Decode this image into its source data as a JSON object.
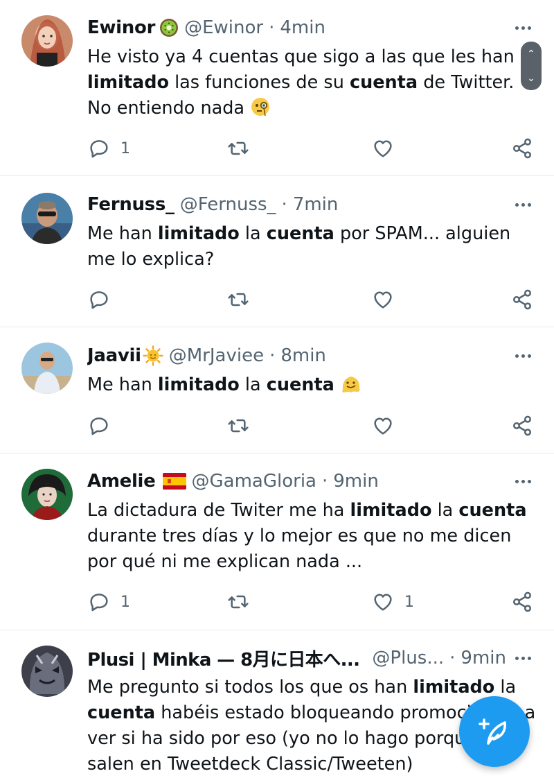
{
  "colors": {
    "accent": "#1d9bf0",
    "text": "#0f1419",
    "muted": "#536471",
    "divider": "#e6e9ec"
  },
  "tweets": [
    {
      "name": "Ewinor",
      "badge": "kiwi-emoji",
      "handle": "@Ewinor",
      "sep": "·",
      "time": "4min",
      "text": [
        {
          "t": "He visto ya 4 cuentas que sigo a las que les han "
        },
        {
          "t": "limitado",
          "b": true
        },
        {
          "t": " las funciones de su "
        },
        {
          "t": "cuenta",
          "b": true
        },
        {
          "t": " de Twitter. No entiendo nada "
        }
      ],
      "trailing_emoji": "monocle-face-emoji",
      "replies": "1",
      "retweets": "",
      "likes": ""
    },
    {
      "name": "Fernuss_",
      "badge": "",
      "handle": "@Fernuss_",
      "sep": "·",
      "time": "7min",
      "text": [
        {
          "t": "Me han "
        },
        {
          "t": "limitado",
          "b": true
        },
        {
          "t": " la "
        },
        {
          "t": "cuenta",
          "b": true
        },
        {
          "t": " por SPAM... alguien me lo explica?"
        }
      ],
      "trailing_emoji": "",
      "replies": "",
      "retweets": "",
      "likes": ""
    },
    {
      "name": "Jaavii",
      "badge": "sun-emoji",
      "handle": "@MrJaviee",
      "sep": "·",
      "time": "8min",
      "text": [
        {
          "t": "Me han "
        },
        {
          "t": "limitado",
          "b": true
        },
        {
          "t": " la "
        },
        {
          "t": "cuenta",
          "b": true
        },
        {
          "t": " "
        }
      ],
      "trailing_emoji": "melting-face-emoji",
      "replies": "",
      "retweets": "",
      "likes": ""
    },
    {
      "name": "Amelie",
      "badge": "spain-flag-emoji",
      "handle": "@GamaGloria",
      "sep": "·",
      "time": "9min",
      "text": [
        {
          "t": "La dictadura de Twiter me ha "
        },
        {
          "t": "limitado",
          "b": true
        },
        {
          "t": " la "
        },
        {
          "t": "cuenta",
          "b": true
        },
        {
          "t": " durante tres días y lo mejor es que no me dicen por qué ni me explican nada ..."
        }
      ],
      "trailing_emoji": "",
      "replies": "1",
      "retweets": "",
      "likes": "1"
    },
    {
      "name": "Plusi | Minka — 8月に日本へ...",
      "badge": "",
      "handle": "@Plus...",
      "sep": "·",
      "time": "9min",
      "text": [
        {
          "t": "Me pregunto si todos los que os han "
        },
        {
          "t": "limitado",
          "b": true
        },
        {
          "t": " la "
        },
        {
          "t": "cuenta",
          "b": true
        },
        {
          "t": " habéis estado bloqueando promociones, a ver si ha sido por eso (yo no lo hago porque me salen en Tweetdeck Classic/Tweeten)"
        }
      ],
      "trailing_emoji": "",
      "replies": "",
      "retweets": "",
      "likes": ""
    }
  ],
  "scroller": {
    "up_icon": "chevron-up-icon",
    "down_icon": "chevron-down-icon"
  },
  "compose_button": {
    "icon": "compose-feather-plus-icon"
  }
}
